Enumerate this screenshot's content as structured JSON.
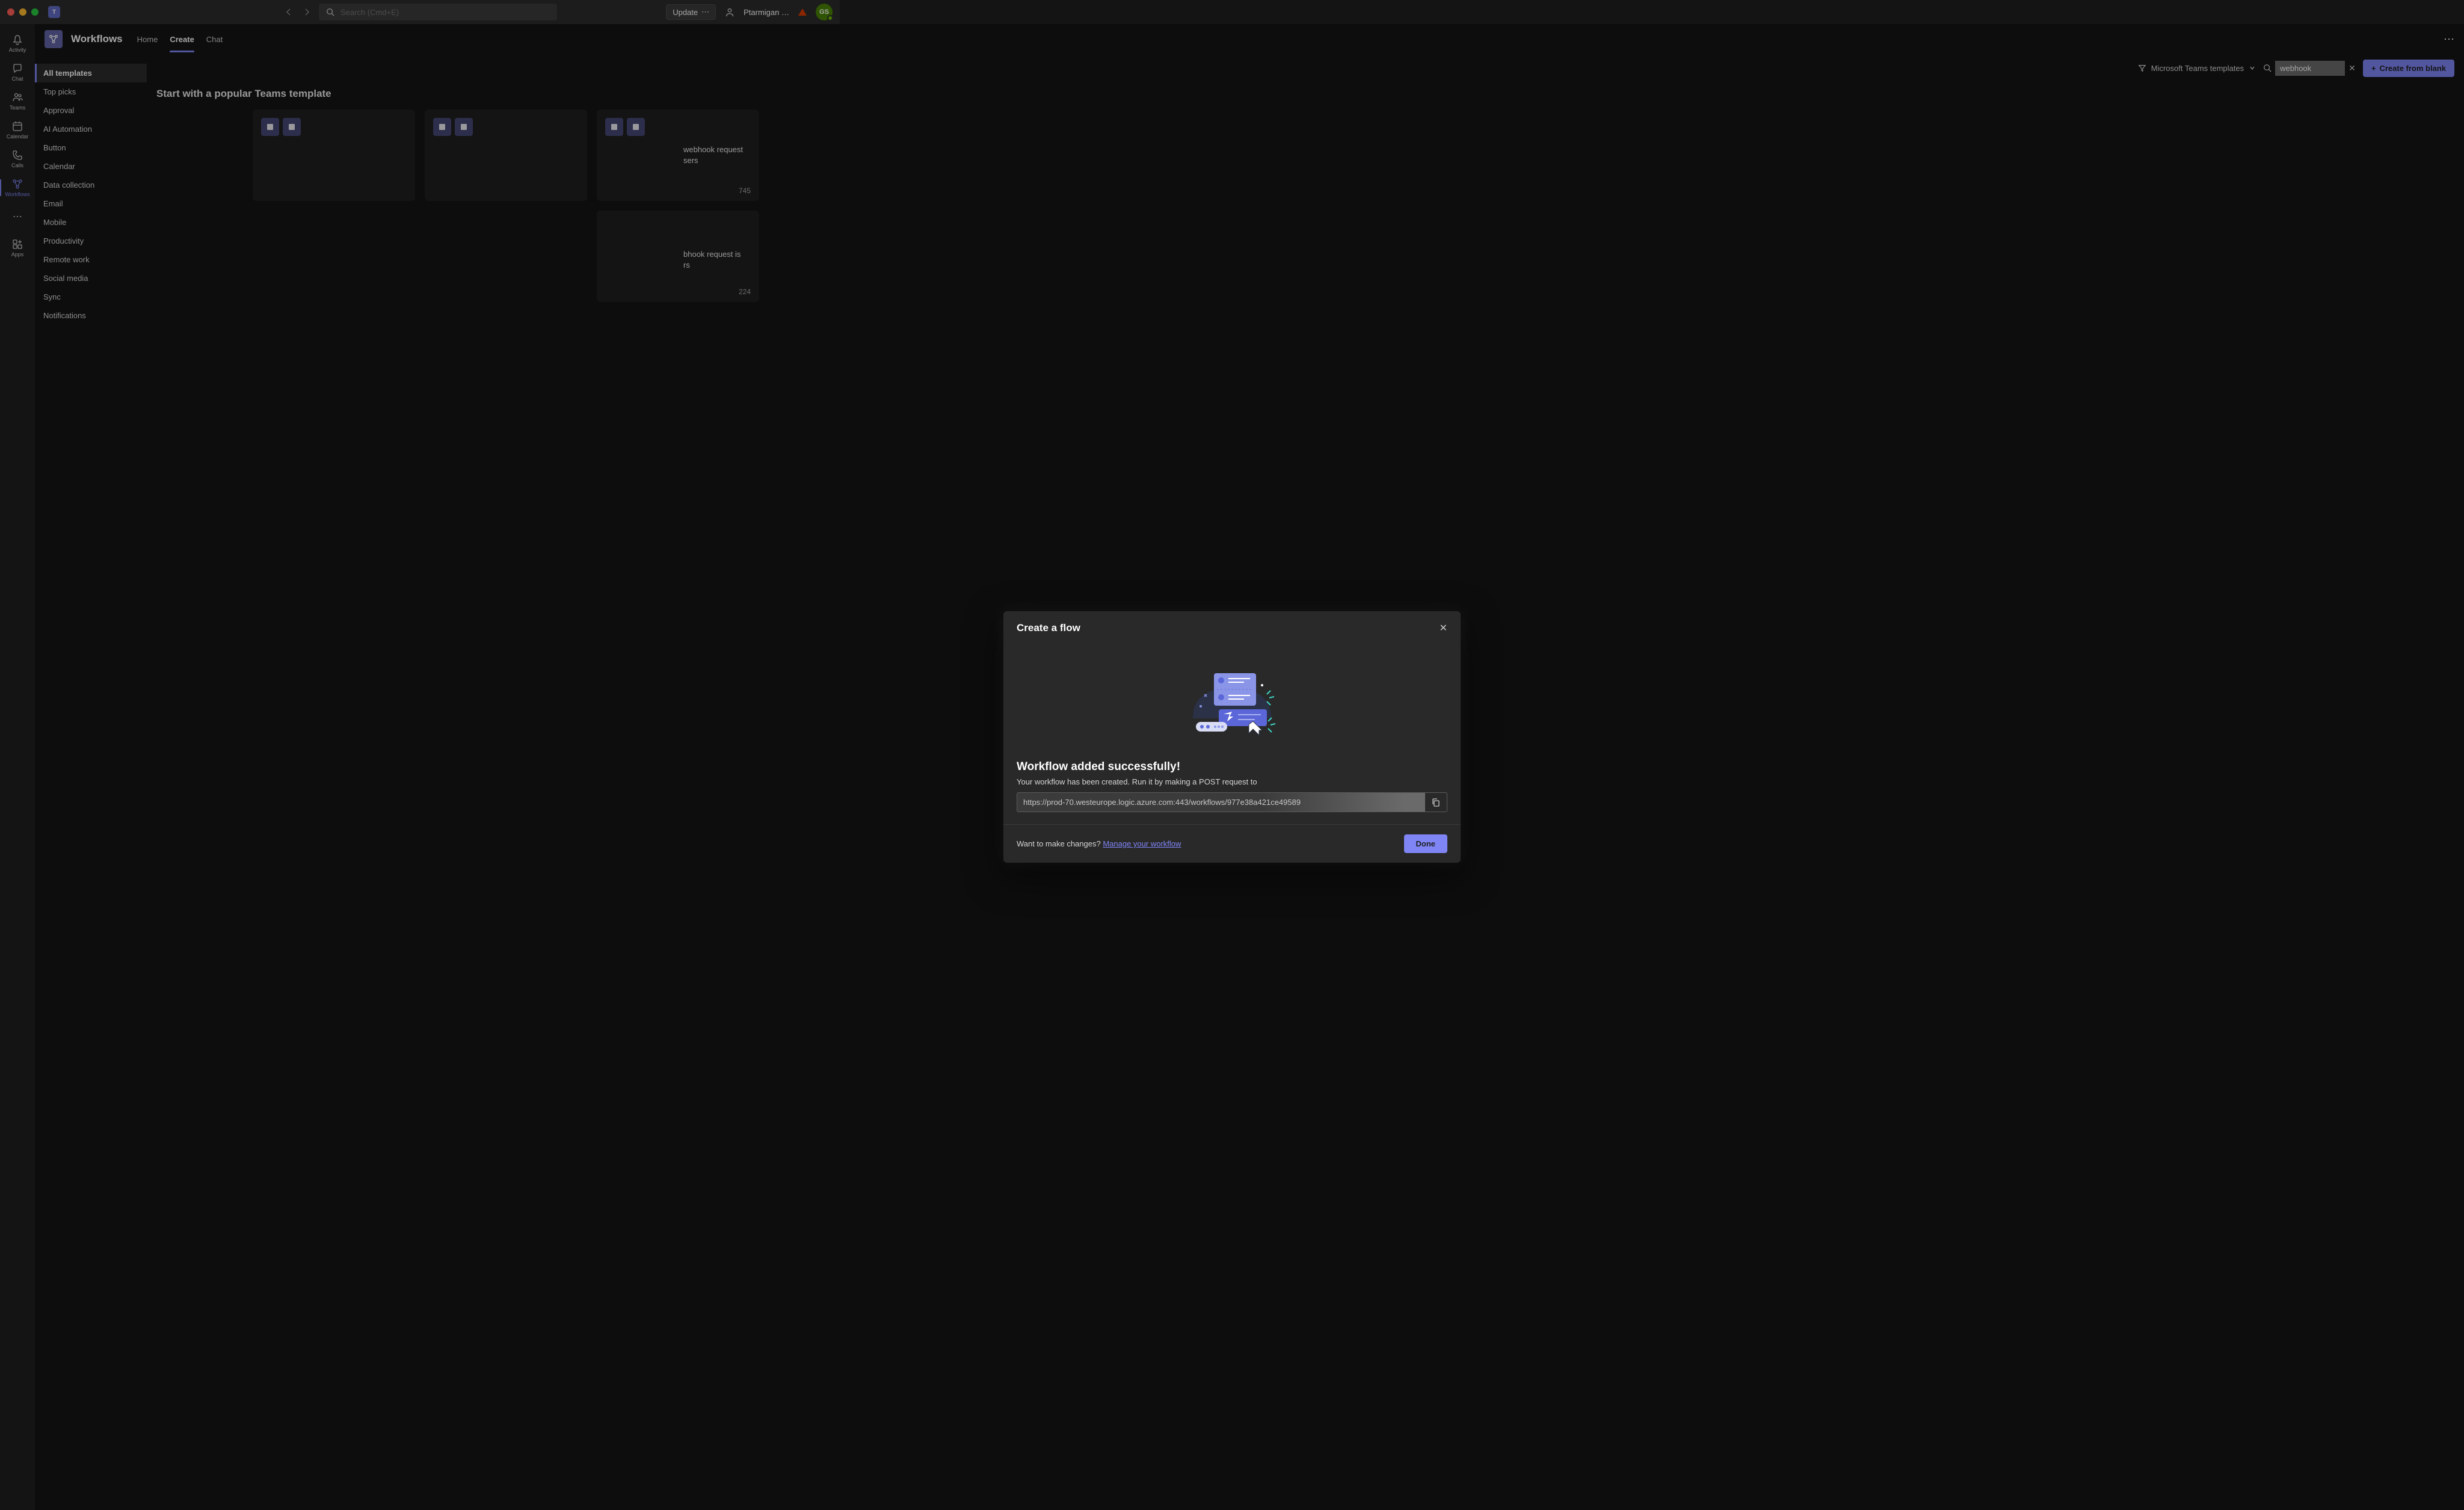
{
  "titlebar": {
    "search_placeholder": "Search (Cmd+E)",
    "update_label": "Update",
    "username": "Ptarmigan …",
    "avatar_initials": "GS"
  },
  "rail": {
    "items": [
      {
        "label": "Activity"
      },
      {
        "label": "Chat"
      },
      {
        "label": "Teams"
      },
      {
        "label": "Calendar"
      },
      {
        "label": "Calls"
      },
      {
        "label": "Workflows"
      }
    ],
    "apps_label": "Apps"
  },
  "header": {
    "app_title": "Workflows",
    "tabs": [
      {
        "label": "Home"
      },
      {
        "label": "Create"
      },
      {
        "label": "Chat"
      }
    ]
  },
  "filterbar": {
    "dropdown_label": "Microsoft Teams templates",
    "search_value": "webhook",
    "create_blank_label": "Create from blank"
  },
  "categories": {
    "items": [
      "All templates",
      "Top picks",
      "Approval",
      "AI Automation",
      "Button",
      "Calendar",
      "Data collection",
      "Email",
      "Mobile",
      "Productivity",
      "Remote work",
      "Social media",
      "Sync",
      "Notifications"
    ]
  },
  "main": {
    "section_title": "Start with a popular Teams template",
    "cards": [
      {
        "title": "",
        "count": ""
      },
      {
        "title": "",
        "count": ""
      },
      {
        "title": "webhook request",
        "subtitle": "sers",
        "count": "745"
      },
      {
        "title": "bhook request is",
        "subtitle": "rs",
        "count": "224"
      }
    ]
  },
  "modal": {
    "title": "Create a flow",
    "success_title": "Workflow added successfully!",
    "success_subtitle": "Your workflow has been created. Run it by making a POST request to",
    "url": "https://prod-70.westeurope.logic.azure.com:443/workflows/977e38a421ce49589",
    "footer_text": "Want to make changes? ",
    "manage_link": "Manage your workflow",
    "done_label": "Done"
  }
}
